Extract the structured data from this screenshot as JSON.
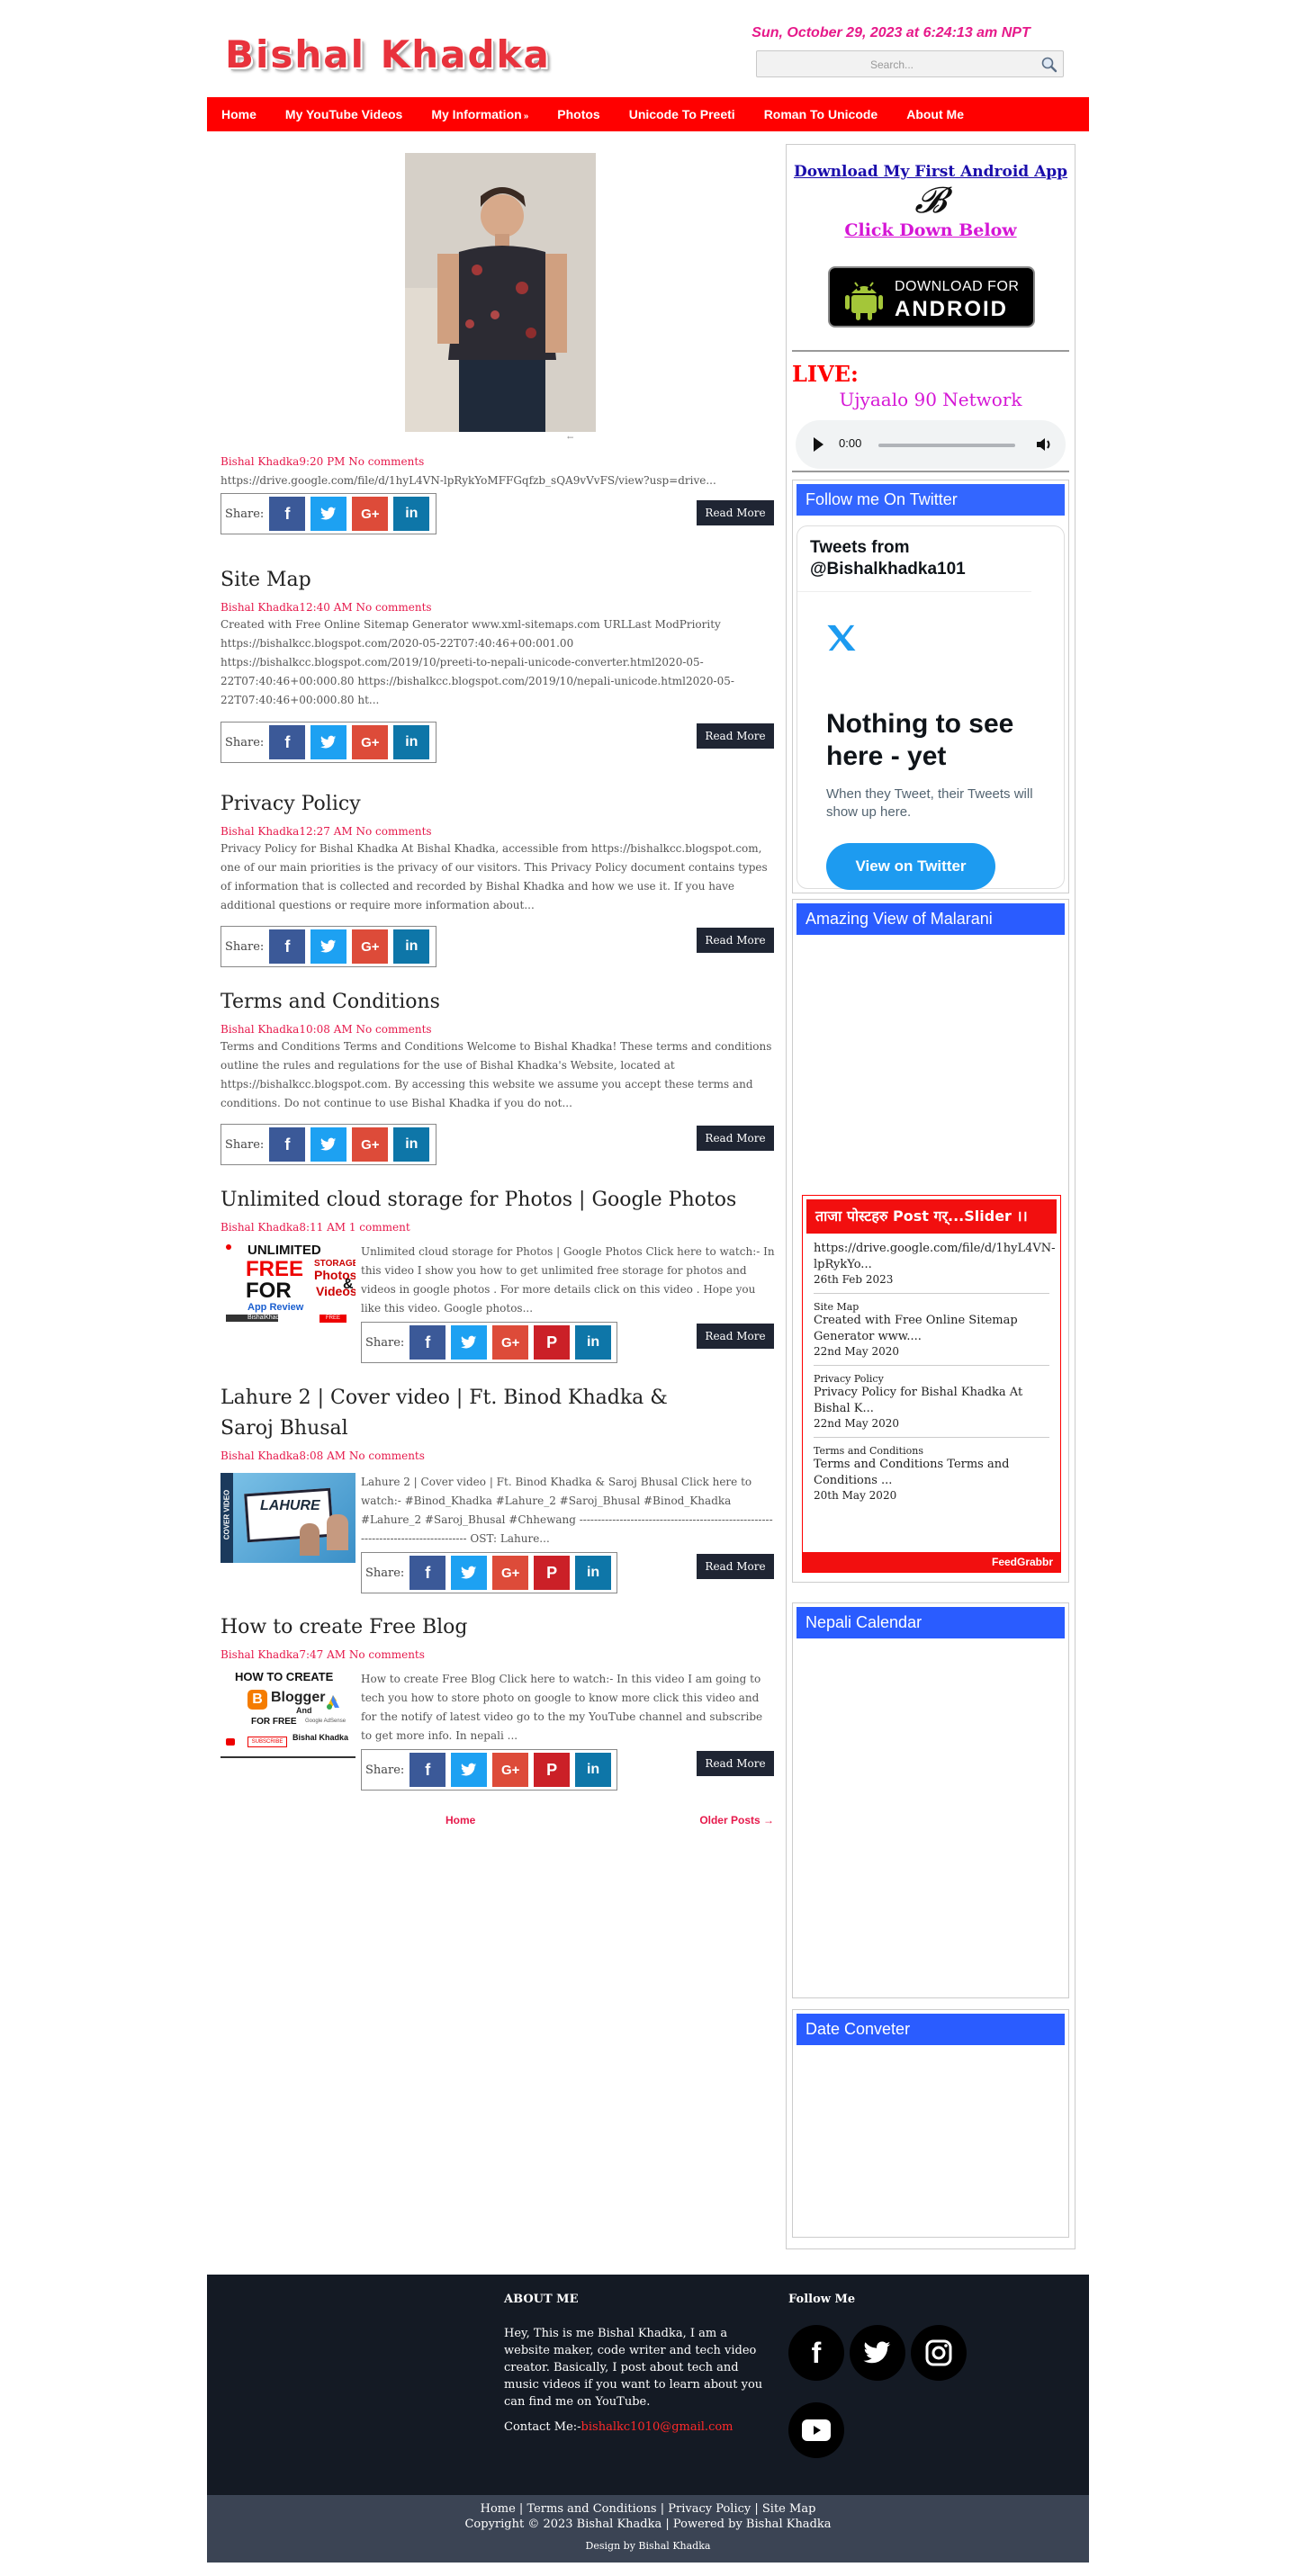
{
  "header": {
    "site_title": "Bishal Khadka",
    "date": "Sun, October 29, 2023 at 6:24:13 am NPT",
    "search_placeholder": "Search..."
  },
  "nav": {
    "items": [
      "Home",
      "My YouTube Videos",
      "My Information",
      "Photos",
      "Unicode To Preeti",
      "Roman To Unicode",
      "About Me"
    ],
    "submenu_arrow": "»"
  },
  "share_label": "Share:",
  "read_more": "Read More",
  "posts": [
    {
      "title": "",
      "author": "Bishal Khadka",
      "time": "9:20 PM",
      "comments": "No comments",
      "snippet": "https://drive.google.com/file/d/1hyL4VN-lpRykYoMFFGqfzb_sQA9vVvFS/view?usp=drive..."
    },
    {
      "title": "Site Map",
      "author": "Bishal Khadka",
      "time": "12:40 AM",
      "comments": "No comments",
      "snippet": "Created with Free Online Sitemap Generator www.xml-sitemaps.com URLLast ModPriority https://bishalkcc.blogspot.com/2020-05-22T07:40:46+00:001.00 https://bishalkcc.blogspot.com/2019/10/preeti-to-nepali-unicode-converter.html2020-05-22T07:40:46+00:000.80 https://bishalkcc.blogspot.com/2019/10/nepali-unicode.html2020-05-22T07:40:46+00:000.80 ht..."
    },
    {
      "title": "Privacy Policy",
      "author": "Bishal Khadka",
      "time": "12:27 AM",
      "comments": "No comments",
      "snippet": "Privacy Policy for Bishal Khadka At Bishal Khadka, accessible from https://bishalkcc.blogspot.com, one of our main priorities is the privacy of our visitors. This Privacy Policy document contains types of information that is collected and recorded by Bishal Khadka and how we use it. If you have additional questions or require more information about..."
    },
    {
      "title": "Terms and Conditions",
      "author": "Bishal Khadka",
      "time": "10:08 AM",
      "comments": "No comments",
      "snippet": "Terms and Conditions  Terms and Conditions Welcome to Bishal Khadka! These terms and conditions outline the rules and regulations for the use of Bishal Khadka's Website, located at https://bishalkcc.blogspot.com. By accessing this website we assume you accept these terms and conditions. Do not continue to use Bishal Khadka if you do not..."
    },
    {
      "title": "Unlimited cloud storage for Photos | Google Photos",
      "author": "Bishal Khadka",
      "time": "8:11 AM",
      "comments": "1 comment",
      "snippet": "Unlimited cloud storage for Photos | Google Photos  Click here to watch:- In this video I show you how to get unlimited free storage for photos and videos in google photos . For more details  click on this video . Hope you like this video.  Google photos...",
      "thumb": {
        "line1": "UNLIMITED",
        "line2": "FREE",
        "line3": "STORAGE",
        "line4": "Photos",
        "line5": "Videos",
        "line6": "FOR",
        "line7": "App Review",
        "amp": "&",
        "badge": "FREE",
        "brand": "BishalKhadka"
      }
    },
    {
      "title": "Lahure 2 | Cover video | Ft. Binod Khadka & Saroj Bhusal",
      "author": "Bishal Khadka",
      "time": "8:08 AM",
      "comments": "No comments",
      "snippet": "Lahure 2 | Cover video | Ft. Binod Khadka & Saroj Bhusal Click here to watch:- #Binod_Khadka #Lahure_2 #Saroj_Bhusal #Binod_Khadka #Lahure_2 #Saroj_Bhusal #Chhewang ---------------------------------------------------------------------------------- OST: Lahure...",
      "thumb": {
        "side": "COVER VIDEO",
        "word": "LAHURE"
      }
    },
    {
      "title": "How to create Free Blog",
      "author": "Bishal Khadka",
      "time": "7:47 AM",
      "comments": "No comments",
      "snippet": "How to create Free Blog  Click here to watch:- In this video I am going to tech you how to store photo on google to know more click this video and for the notify of latest video go to the my YouTube  channel and subscribe to get more info. In nepali ...",
      "thumb": {
        "line1": "HOW TO CREATE",
        "line2": "Blogger",
        "line3": "And",
        "line4": "FOR FREE",
        "line5": "Google AdSense",
        "brand": "Bishal Khadka",
        "sub": "SUBSCRIBE"
      }
    }
  ],
  "pager": {
    "home": "Home",
    "older": "Older Posts →"
  },
  "sidebar": {
    "app": {
      "heading": "Download My First Android App",
      "link": "Click Down Below",
      "badge_top": "DOWNLOAD FOR",
      "badge_bottom": "ANDROID"
    },
    "live": {
      "label": "LIVE:",
      "station": "Ujyaalo 90 Network",
      "time": "0:00"
    },
    "twitter": {
      "title": "Follow me On Twitter",
      "header": "Tweets from @Bishalkhadka101",
      "empty_title": "Nothing to see here - yet",
      "empty_text": "When they Tweet, their Tweets will show up here.",
      "button": "View on Twitter"
    },
    "malarani": {
      "title": "Amazing View of Malarani"
    },
    "slider": {
      "title": "ताजा पोस्टहरु Post गर्...Slider ।।",
      "items": [
        {
          "title": "",
          "text": "https://drive.google.com/file/d/1hyL4VN-lpRykYo...",
          "date": "26th Feb 2023"
        },
        {
          "title": "Site Map",
          "text": "Created with Free Online Sitemap Generator www....",
          "date": "22nd May 2020"
        },
        {
          "title": "Privacy Policy",
          "text": "Privacy Policy for Bishal Khadka At Bishal K...",
          "date": "22nd May 2020"
        },
        {
          "title": "Terms and Conditions",
          "text": "Terms and Conditions  Terms and Conditions ...",
          "date": "20th May 2020"
        }
      ],
      "credit": "FeedGrabbr"
    },
    "calendar": {
      "title": "Nepali Calendar"
    },
    "converter": {
      "title": "Date Conveter"
    }
  },
  "footer": {
    "about_title": "ABOUT ME",
    "about_text": "Hey, This is me Bishal Khadka, I am a website maker, code writer and tech video creator. Basically, I post about tech and music videos if you want to learn about you can find me on YouTube.",
    "contact_label": "Contact Me:-",
    "contact_email": "bishalkc1010@gmail.com",
    "follow_title": "Follow Me",
    "links": [
      "Home",
      "Terms and Conditions",
      "Privacy Policy",
      "Site Map"
    ],
    "copyright": "Copyright © 2023 Bishal Khadka | Powered by Bishal Khadka",
    "design": "Design by Bishal Khadka"
  }
}
